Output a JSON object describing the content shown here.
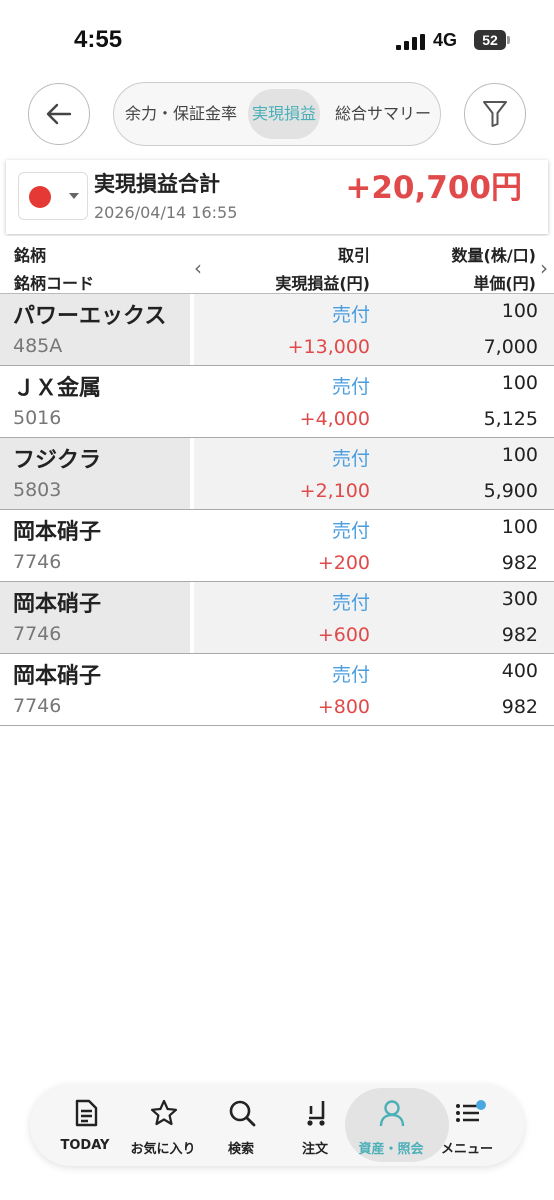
{
  "status_bar": {
    "time": "4:55",
    "network": "4G",
    "battery": "52"
  },
  "nav": {
    "segments": [
      "余力・保証金率",
      "実現損益",
      "総合サマリー"
    ],
    "active_segment": "実現損益"
  },
  "summary": {
    "title": "実現損益合計",
    "date": "2026/04/14 16:55",
    "total": "+20,700円"
  },
  "table": {
    "headers": {
      "name": "銘柄",
      "code": "銘柄コード",
      "trade": "取引",
      "pnl": "実現損益(円)",
      "qty": "数量(株/口)",
      "price": "単価(円)"
    },
    "rows": [
      {
        "name": "パワーエックス",
        "code": "485A",
        "trade": "売付",
        "pnl": "+13,000",
        "qty": "100",
        "price": "7,000"
      },
      {
        "name": "ＪＸ金属",
        "code": "5016",
        "trade": "売付",
        "pnl": "+4,000",
        "qty": "100",
        "price": "5,125"
      },
      {
        "name": "フジクラ",
        "code": "5803",
        "trade": "売付",
        "pnl": "+2,100",
        "qty": "100",
        "price": "5,900"
      },
      {
        "name": "岡本硝子",
        "code": "7746",
        "trade": "売付",
        "pnl": "+200",
        "qty": "100",
        "price": "982"
      },
      {
        "name": "岡本硝子",
        "code": "7746",
        "trade": "売付",
        "pnl": "+600",
        "qty": "300",
        "price": "982"
      },
      {
        "name": "岡本硝子",
        "code": "7746",
        "trade": "売付",
        "pnl": "+800",
        "qty": "400",
        "price": "982"
      }
    ]
  },
  "tab_bar": {
    "tabs": [
      {
        "label": "TODAY",
        "icon": "news-icon"
      },
      {
        "label": "お気に入り",
        "icon": "star-icon"
      },
      {
        "label": "検索",
        "icon": "search-icon"
      },
      {
        "label": "注文",
        "icon": "cart-icon"
      },
      {
        "label": "資産・照会",
        "icon": "person-icon"
      },
      {
        "label": "メニュー",
        "icon": "menu-icon"
      }
    ],
    "active_tab": "資産・照会"
  },
  "colors": {
    "accent": "#4cb0b8",
    "profit": "#e04a4a",
    "trade_type": "#4a9ee0",
    "flag": "#e53935"
  }
}
